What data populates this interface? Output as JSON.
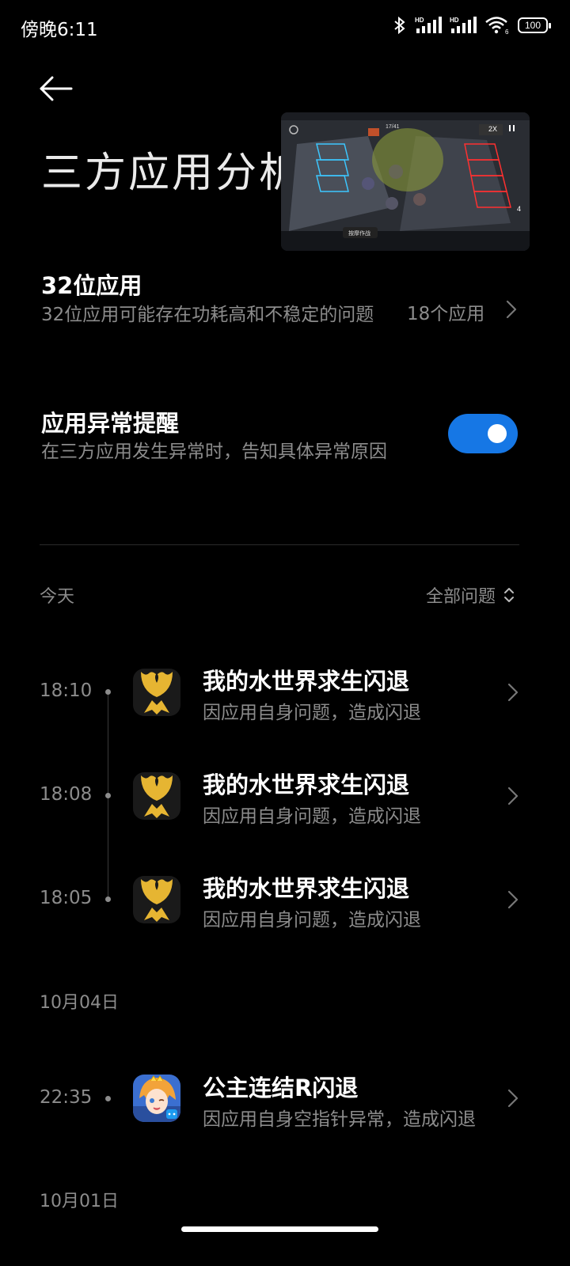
{
  "status_bar": {
    "time": "傍晚6:11",
    "battery": "100",
    "icons": [
      "bluetooth-icon",
      "signal-hd-icon",
      "signal-hd-icon",
      "wifi-icon",
      "battery-icon"
    ]
  },
  "header": {
    "back_icon": "arrow-left-icon",
    "title": "三方应用分析"
  },
  "pip": {
    "description_icon": "floating-game-window",
    "wave": "17/41",
    "speed": "2X",
    "life": "4",
    "hint": "按摩作战"
  },
  "apps_32bit": {
    "title": "32位应用",
    "description": "32位应用可能存在功耗高和不稳定的问题",
    "count": "18个应用"
  },
  "anomaly_alert": {
    "title": "应用异常提醒",
    "description": "在三方应用发生异常时，告知具体异常原因",
    "enabled": true
  },
  "list": {
    "today_label": "今天",
    "filter_label": "全部问题",
    "groups": [
      {
        "date": "今天",
        "events": [
          {
            "time": "18:10",
            "title": "我的水世界求生闪退",
            "desc": "因应用自身问题，造成闪退",
            "icon": "water-world-app-icon"
          },
          {
            "time": "18:08",
            "title": "我的水世界求生闪退",
            "desc": "因应用自身问题，造成闪退",
            "icon": "water-world-app-icon"
          },
          {
            "time": "18:05",
            "title": "我的水世界求生闪退",
            "desc": "因应用自身问题，造成闪退",
            "icon": "water-world-app-icon"
          }
        ]
      },
      {
        "date": "10月04日",
        "events": [
          {
            "time": "22:35",
            "title": "公主连结R闪退",
            "desc": "因应用自身空指针异常，造成闪退",
            "icon": "princess-connect-app-icon"
          }
        ]
      },
      {
        "date": "10月01日",
        "events": []
      }
    ]
  },
  "colors": {
    "background": "#000000",
    "accent": "#1677e5",
    "secondary_text": "#8c8c8c"
  }
}
